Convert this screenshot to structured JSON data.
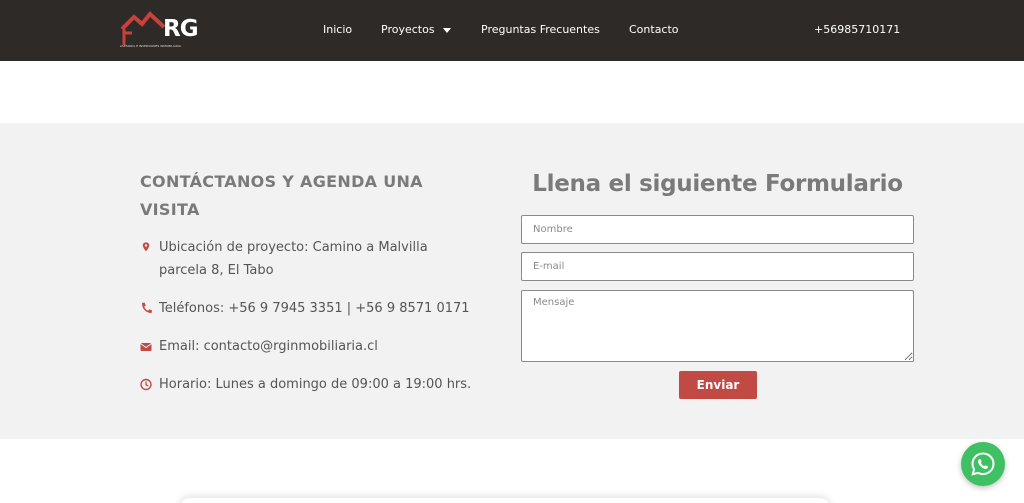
{
  "header": {
    "logo": {
      "text": "RG",
      "subtitle": "ASESORÍA E INVERSIONES INMOBILIARIA"
    },
    "nav": [
      {
        "label": "Inicio"
      },
      {
        "label": "Proyectos",
        "has_dropdown": true
      },
      {
        "label": "Preguntas Frecuentes"
      },
      {
        "label": "Contacto"
      }
    ],
    "phone": "+56985710171"
  },
  "contact": {
    "title": "CONTÁCTANOS Y AGENDA UNA VISITA",
    "items": [
      {
        "icon": "map-pin-icon",
        "text": "Ubicación de proyecto: Camino a Malvilla parcela 8, El Tabo"
      },
      {
        "icon": "phone-icon",
        "text": "Teléfonos: +56 9 7945 3351 | +56 9 8571 0171"
      },
      {
        "icon": "mail-icon",
        "text": "Email: contacto@rginmobiliaria.cl"
      },
      {
        "icon": "clock-icon",
        "text": "Horario: Lunes a domingo de 09:00 a 19:00 hrs."
      }
    ]
  },
  "form": {
    "title": "Llena el siguiente Formulario",
    "name_placeholder": "Nombre",
    "email_placeholder": "E-mail",
    "message_placeholder": "Mensaje",
    "submit_label": "Enviar"
  },
  "colors": {
    "header_bg": "#2e2a27",
    "accent": "#c24a45",
    "section_bg": "#f2f2f2",
    "whatsapp": "#3fc063"
  }
}
